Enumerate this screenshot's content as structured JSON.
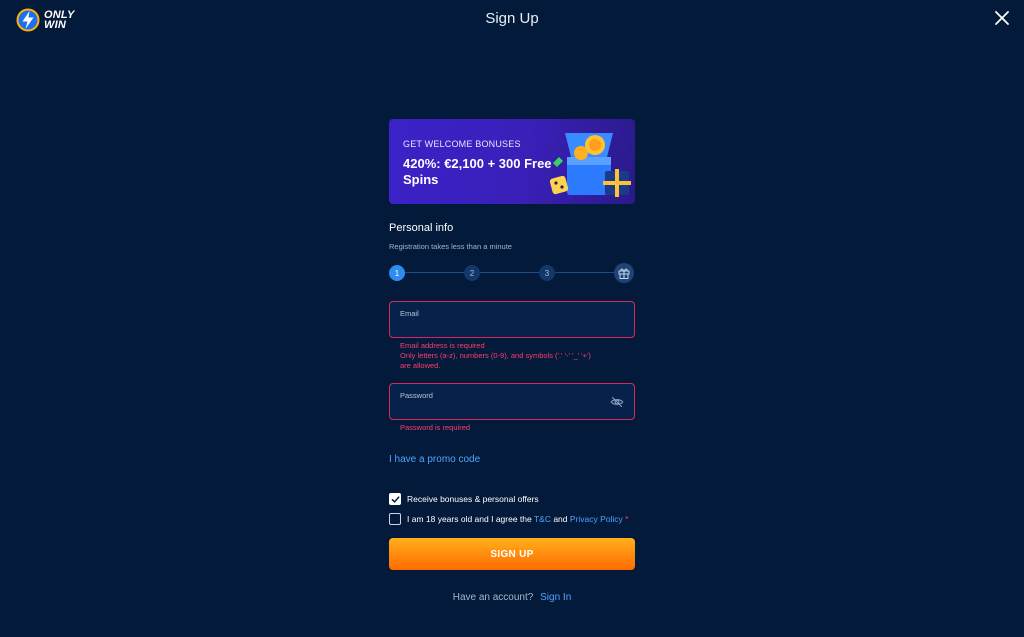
{
  "header": {
    "logo_line1": "ONLY",
    "logo_line2": "WIN",
    "title": "Sign Up"
  },
  "banner": {
    "eyebrow": "GET WELCOME BONUSES",
    "headline": "420%: €2,100 + 300 Free Spins"
  },
  "personal_info": {
    "title": "Personal info",
    "subtitle": "Registration takes less than a minute",
    "steps": [
      "1",
      "2",
      "3"
    ],
    "active_step": 1
  },
  "email": {
    "label": "Email",
    "value": "",
    "errors": [
      "Email address is required",
      "Only letters (a-z), numbers (0-9), and symbols ('.' '-' '_' '+')",
      "are allowed."
    ]
  },
  "password": {
    "label": "Password",
    "value": "",
    "errors": [
      "Password is required"
    ]
  },
  "promo": {
    "label": "I have a promo code"
  },
  "consent": {
    "bonuses_label": "Receive bonuses & personal offers",
    "bonuses_checked": true,
    "age_prefix": "I am 18 years old and I agree the ",
    "tc_link": "T&C",
    "and_text": " and ",
    "privacy_link": "Privacy Policy",
    "required_mark": " *",
    "age_checked": false
  },
  "signup_button": "SIGN UP",
  "signin": {
    "prompt": "Have an account?",
    "link": "Sign In"
  },
  "colors": {
    "background": "#031a3a",
    "error": "#ff3d6e",
    "link": "#4fa4ff",
    "accent_orange": "#ff8a00",
    "step_active": "#2d8cf0"
  }
}
